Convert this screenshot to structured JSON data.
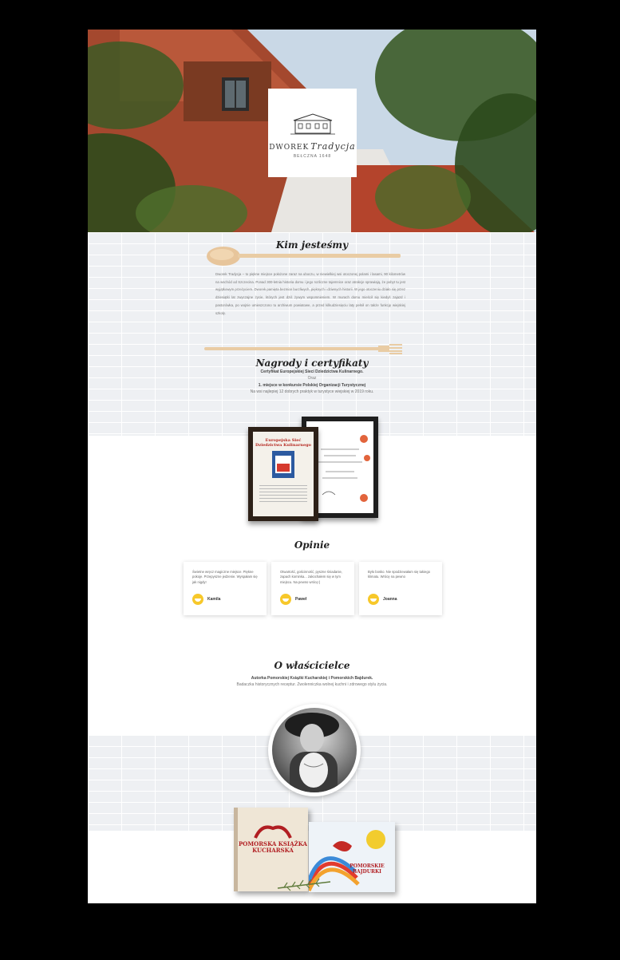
{
  "hero": {
    "logo_brand": "DWOREK",
    "logo_script": "Tradycja",
    "logo_sub": "BEŁCZNA 1648"
  },
  "about": {
    "heading": "Kim jesteśmy",
    "text": "Dworek Tradycja – to piękne miejsce położone zaraz na uboczu, w niewielkiej wsi otoczonej polami i lasami, 90 kilometrów na wschód od Szczecina. Ponad 300-letnia historia domu i jego rozliczne tajemnice oraz atrakcje sprawiają, że pobyt tu jest wyjątkowym przeżyciem. Dworek pamięta bezmiar burzliwych, pięknych i dziwnych historii. W jego otoczeniu działo się przez dziesiątki lat zwyczajne życie, których jest dziś żywym wspomnieniem. W murach domu mieścił się kiedyś zajazd i pastorówka, po wojnie umieszczono tu archiwum powiatowe, a przed kilkudziesięciu laty pełnił on także funkcję wiejskiej szkoły."
  },
  "awards": {
    "heading": "Nagrody i certyfikaty",
    "line1": "Certyfikat Europejskiej Sieci Dziedzictwa Kulinarnego.",
    "line2": "Oraz",
    "line3": "1. miejsce w konkursie Polskiej Organizacji Turystycznej",
    "line4": "Na wsi najlepiej 12 dobrych praktyk w turystyce wiejskiej w 2019 roku.",
    "cert1_title": "Europejska Sieć Dziedzictwa Kulinarnego"
  },
  "reviews": {
    "heading": "Opinie",
    "items": [
      {
        "text": "Świetne wręcz magiczne miejsce. Piękne pokoje. Przepyszne jedzenie. Wyspałam się jak nigdy!",
        "name": "Kamila"
      },
      {
        "text": "Otwartość, gościnność, pyszne śniadanie, zapach kominka... zakochałem się w tym miejscu. Na pewno wrócę:)",
        "name": "Paweł"
      },
      {
        "text": "Było bosko. Nie spodziewałam się takiego klimatu. Wrócę na pewno",
        "name": "Joanna"
      }
    ]
  },
  "owner": {
    "heading": "O właścicielce",
    "line1": "Autorka Pomorskiej Książki Kucharskiej i Pomorskich Bajdurek.",
    "line2": "Badaczka historycznych receptur. Zwolenniczka wolnej kuchni i zdrowego stylu życia.",
    "book1_title": "POMORSKA KSIĄŻKA KUCHARSKA",
    "book2_title": "POMORSKIE BAJDURKI"
  },
  "colors": {
    "background": "#000000",
    "accent": "#b11e22",
    "review_avatar": "#f7c82a"
  }
}
